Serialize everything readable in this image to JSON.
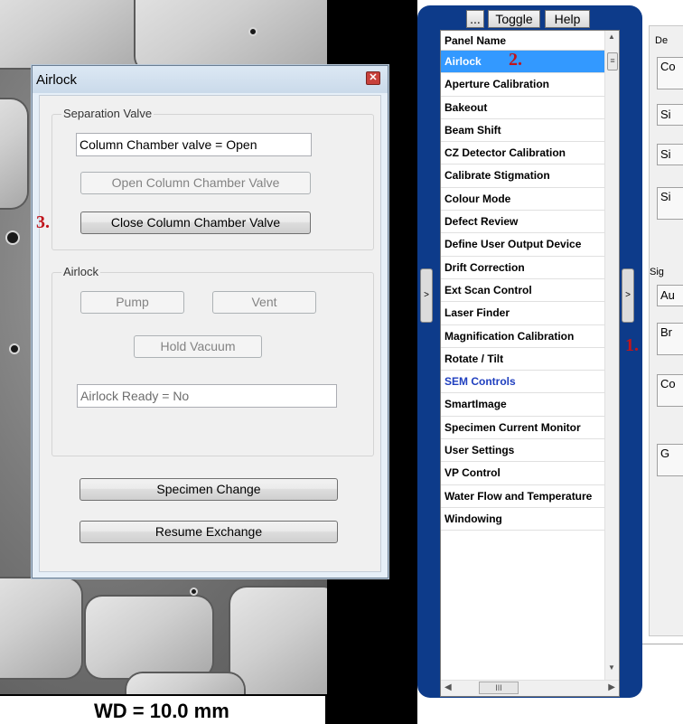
{
  "sem_image": {
    "wd_label": "WD = 10.0 mm"
  },
  "airlock_dialog": {
    "title": "Airlock",
    "close_icon": "✕",
    "separation_valve": {
      "legend": "Separation Valve",
      "status_text": "Column Chamber valve = Open",
      "open_button": "Open Column Chamber Valve",
      "close_button": "Close Column Chamber Valve"
    },
    "airlock_group": {
      "legend": "Airlock",
      "pump_button": "Pump",
      "vent_button": "Vent",
      "hold_vacuum_button": "Hold Vacuum",
      "status_text": "Airlock Ready = No"
    },
    "specimen_change_button": "Specimen Change",
    "resume_exchange_button": "Resume Exchange"
  },
  "annotations": {
    "step1": "1.",
    "step2": "2.",
    "step3": "3."
  },
  "panel_list": {
    "toolbar": {
      "more_label": "...",
      "toggle_label": "Toggle",
      "help_label": "Help"
    },
    "collapse_left_label": ">",
    "collapse_right_label": ">",
    "header": "Panel Name",
    "items": [
      "Airlock",
      "Aperture Calibration",
      "Bakeout",
      "Beam Shift",
      "CZ Detector Calibration",
      "Calibrate Stigmation",
      "Colour Mode",
      "Defect Review",
      "Define User Output Device",
      "Drift Correction",
      "Ext Scan Control",
      "Laser Finder",
      "Magnification Calibration",
      "Rotate / Tilt",
      "SEM Controls",
      "SmartImage",
      "Specimen Current Monitor",
      "User Settings",
      "VP Control",
      "Water Flow and Temperature",
      "Windowing"
    ],
    "selected_index": 0,
    "highlighted_index": 14,
    "hscroll_label": "III"
  },
  "right_panel": {
    "de_label": "De",
    "co_label_1": "Co",
    "si_label_1": "Si",
    "si_label_2": "Si",
    "si_label_3": "Si",
    "sig_label": "Sig",
    "au_label": "Au",
    "br_label": "Br",
    "co_label_2": "Co",
    "g_label": "G"
  }
}
